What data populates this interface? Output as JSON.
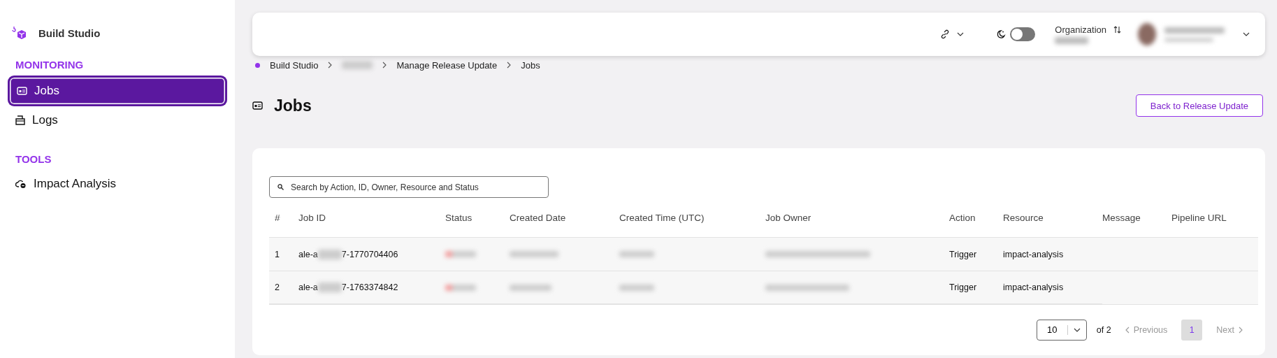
{
  "sidebar": {
    "brand": "Build Studio",
    "sections": [
      {
        "title": "MONITORING",
        "items": [
          {
            "label": "Jobs",
            "kind": "jobs",
            "selected": true
          },
          {
            "label": "Logs",
            "kind": "logs",
            "selected": false
          }
        ]
      },
      {
        "title": "TOOLS",
        "items": [
          {
            "label": "Impact Analysis",
            "kind": "impact",
            "selected": false
          }
        ]
      }
    ]
  },
  "header": {
    "dark_mode": {
      "on": false
    },
    "organization_label": "Organization"
  },
  "breadcrumb": [
    {
      "label": "Build Studio",
      "kind": "text"
    },
    {
      "kind": "blurred"
    },
    {
      "label": "Manage Release Update",
      "kind": "text"
    },
    {
      "label": "Jobs",
      "kind": "text"
    }
  ],
  "page": {
    "title": "Jobs",
    "back_button": "Back to Release Update"
  },
  "search": {
    "placeholder": "Search by Action, ID, Owner, Resource and Status"
  },
  "table": {
    "columns": [
      "#",
      "Job ID",
      "Status",
      "Created Date",
      "Created Time (UTC)",
      "Job Owner",
      "Action",
      "Resource",
      "Message",
      "Pipeline URL"
    ],
    "rows": [
      {
        "index": "1",
        "job_id_start": "ale-a",
        "job_id_end": "7-1770704406",
        "action": "Trigger",
        "resource": "impact-analysis"
      },
      {
        "index": "2",
        "job_id_start": "ale-a",
        "job_id_end": "7-1763374842",
        "action": "Trigger",
        "resource": "impact-analysis"
      }
    ]
  },
  "pagination": {
    "page_size": "10",
    "of_pages": "of 2",
    "previous": "Previous",
    "pages": [
      {
        "label": "1",
        "selected": true
      }
    ],
    "next": "Next"
  }
}
